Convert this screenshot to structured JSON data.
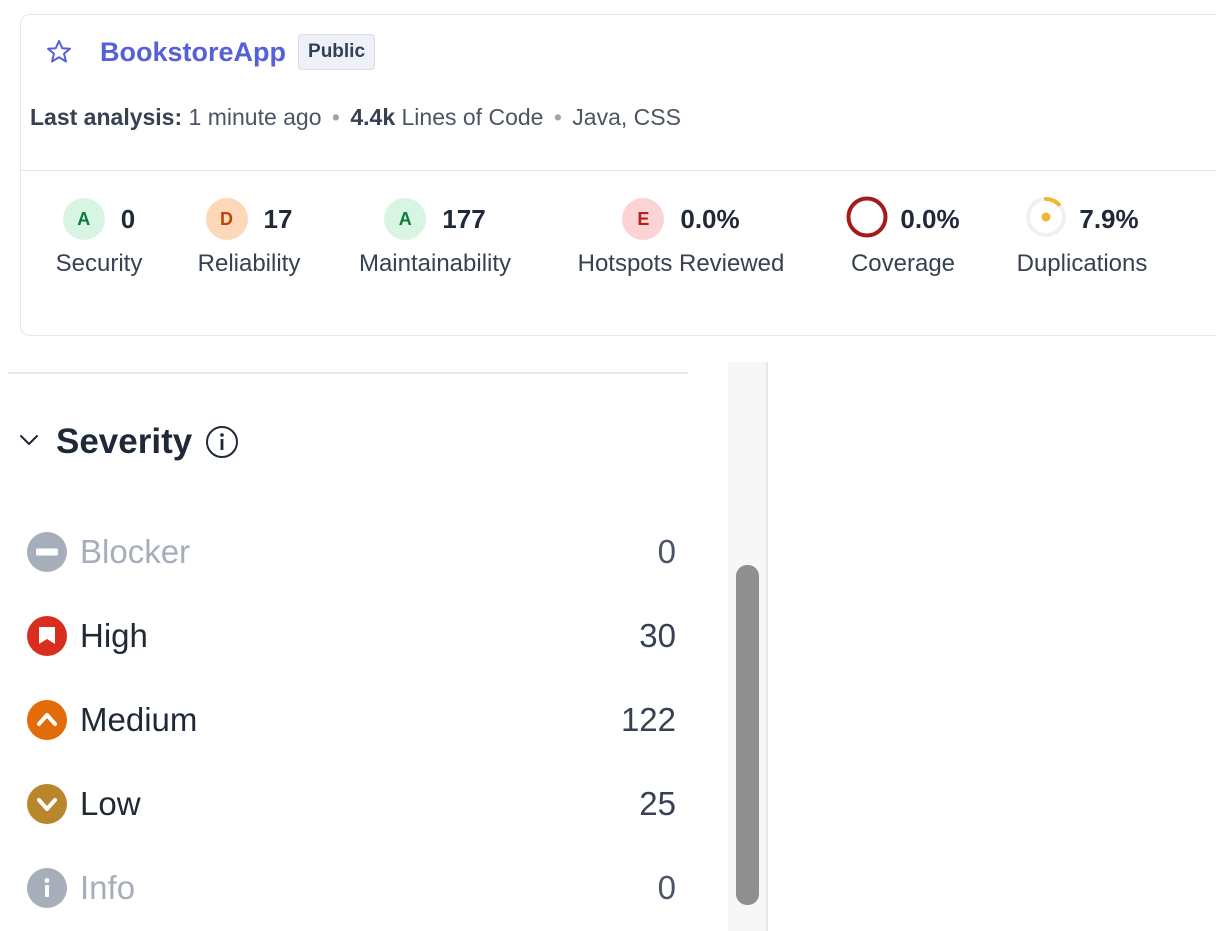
{
  "project": {
    "name": "BookstoreApp",
    "visibility": "Public",
    "last_analysis_label": "Last analysis:",
    "last_analysis_value": "1 minute ago",
    "loc_value": "4.4k",
    "loc_label": "Lines of Code",
    "languages": "Java, CSS"
  },
  "metrics": {
    "security": {
      "grade": "A",
      "value": "0",
      "label": "Security"
    },
    "reliability": {
      "grade": "D",
      "value": "17",
      "label": "Reliability"
    },
    "maintainability": {
      "grade": "A",
      "value": "177",
      "label": "Maintainability"
    },
    "hotspots": {
      "grade": "E",
      "value": "0.0%",
      "label": "Hotspots Reviewed"
    },
    "coverage": {
      "value": "0.0%",
      "label": "Coverage"
    },
    "duplications": {
      "value": "7.9%",
      "label": "Duplications",
      "progress": 0.079
    }
  },
  "facet": {
    "title": "Severity",
    "items": [
      {
        "label": "Blocker",
        "count": "0"
      },
      {
        "label": "High",
        "count": "30"
      },
      {
        "label": "Medium",
        "count": "122"
      },
      {
        "label": "Low",
        "count": "25"
      },
      {
        "label": "Info",
        "count": "0"
      }
    ]
  },
  "colors": {
    "link": "#5561d6",
    "grade_a_bg": "#d8f5e3",
    "grade_a_fg": "#0d7a3c",
    "grade_d_bg": "#fdd8b8",
    "grade_d_fg": "#b54708",
    "grade_e_bg": "#fcd3d4",
    "grade_e_fg": "#b42318",
    "coverage_ring": "#a31b1b",
    "duplication_arc": "#f2b531",
    "high": "#d92d20",
    "medium": "#e26b0a",
    "low": "#b8862b",
    "muted": "#a6adbb"
  }
}
